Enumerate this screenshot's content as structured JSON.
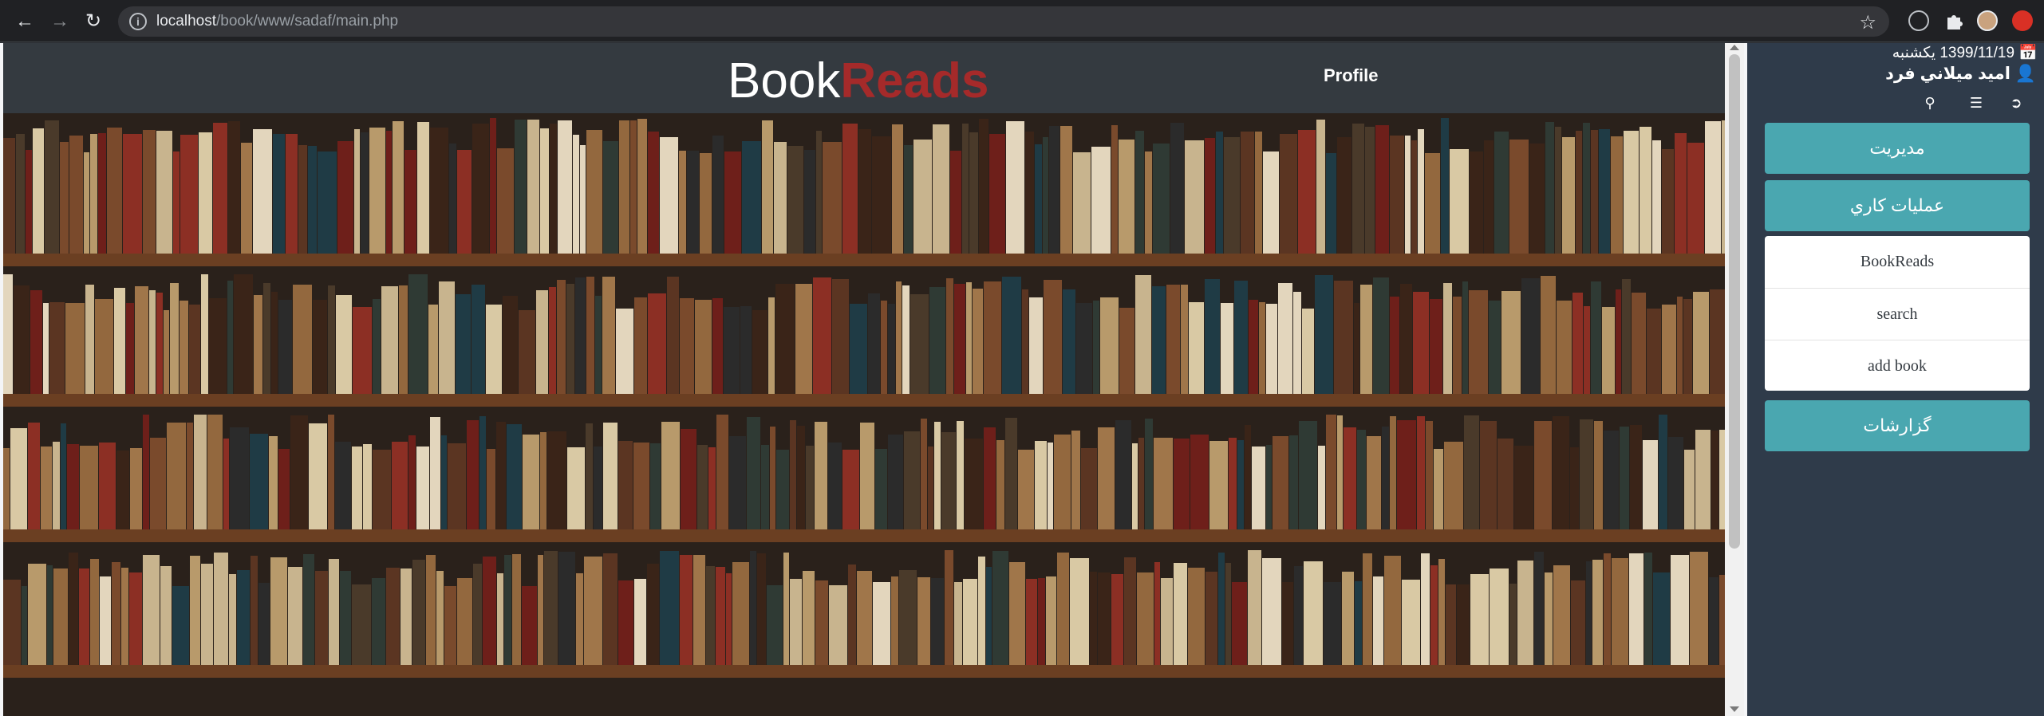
{
  "browser": {
    "url_host": "localhost",
    "url_path": "/book/www/sadaf/main.php",
    "back_icon": "arrow-left-icon",
    "forward_icon": "arrow-right-icon",
    "reload_icon": "reload-icon",
    "info_icon": "info-icon",
    "bookmark_icon": "star-icon",
    "info_glyph": "i"
  },
  "header": {
    "brand_part1": "Book",
    "brand_part2": "Reads",
    "brand_accent_color": "#a52a2a",
    "profile_label": "Profile"
  },
  "sidebar": {
    "date": "1399/11/19 يكشنبه",
    "user_name": "اميد ميلاني فرد",
    "calendar_icon": "calendar-icon",
    "user_icon": "user-icon",
    "tools": [
      "key-icon",
      "list-icon",
      "logout-icon"
    ],
    "menu": [
      {
        "label": "مديريت"
      },
      {
        "label": "عمليات كاري"
      },
      {
        "label": "گزارشات"
      }
    ],
    "submenu": [
      {
        "label": "BookReads"
      },
      {
        "label": "search"
      },
      {
        "label": "add book"
      }
    ],
    "menu_color": "#4aa7b0"
  }
}
